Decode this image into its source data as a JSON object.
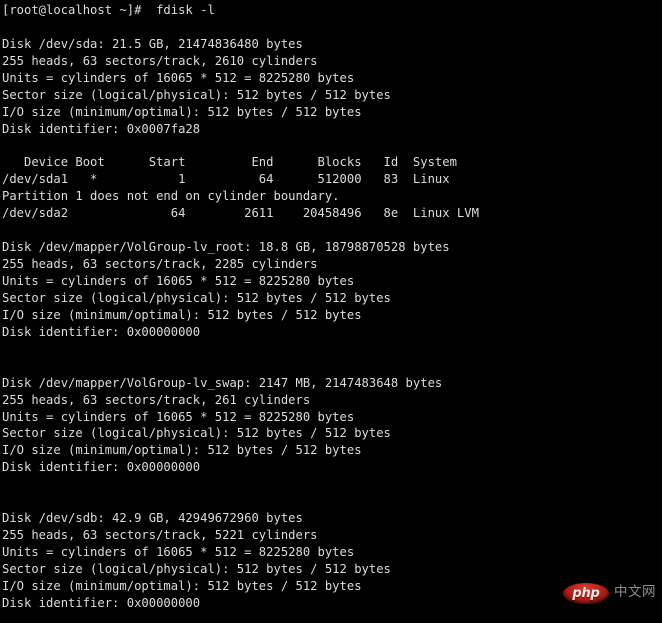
{
  "terminal": {
    "prompt": "[root@localhost ~]#",
    "command": "fdisk -l",
    "prompt_line": "[root@localhost ~]#  fdisk -l",
    "text_color": "#dcdcdc",
    "background_color": "#000000",
    "lines": [
      "[root@localhost ~]#  fdisk -l",
      "",
      "Disk /dev/sda: 21.5 GB, 21474836480 bytes",
      "255 heads, 63 sectors/track, 2610 cylinders",
      "Units = cylinders of 16065 * 512 = 8225280 bytes",
      "Sector size (logical/physical): 512 bytes / 512 bytes",
      "I/O size (minimum/optimal): 512 bytes / 512 bytes",
      "Disk identifier: 0x0007fa28",
      "",
      "   Device Boot      Start         End      Blocks   Id  System",
      "/dev/sda1   *           1          64      512000   83  Linux",
      "Partition 1 does not end on cylinder boundary.",
      "/dev/sda2              64        2611    20458496   8e  Linux LVM",
      "",
      "Disk /dev/mapper/VolGroup-lv_root: 18.8 GB, 18798870528 bytes",
      "255 heads, 63 sectors/track, 2285 cylinders",
      "Units = cylinders of 16065 * 512 = 8225280 bytes",
      "Sector size (logical/physical): 512 bytes / 512 bytes",
      "I/O size (minimum/optimal): 512 bytes / 512 bytes",
      "Disk identifier: 0x00000000",
      "",
      "",
      "Disk /dev/mapper/VolGroup-lv_swap: 2147 MB, 2147483648 bytes",
      "255 heads, 63 sectors/track, 261 cylinders",
      "Units = cylinders of 16065 * 512 = 8225280 bytes",
      "Sector size (logical/physical): 512 bytes / 512 bytes",
      "I/O size (minimum/optimal): 512 bytes / 512 bytes",
      "Disk identifier: 0x00000000",
      "",
      "",
      "Disk /dev/sdb: 42.9 GB, 42949672960 bytes",
      "255 heads, 63 sectors/track, 5221 cylinders",
      "Units = cylinders of 16065 * 512 = 8225280 bytes",
      "Sector size (logical/physical): 512 bytes / 512 bytes",
      "I/O size (minimum/optimal): 512 bytes / 512 bytes",
      "Disk identifier: 0x00000000"
    ],
    "disks": [
      {
        "device": "/dev/sda",
        "size_human": "21.5 GB",
        "size_bytes": "21474836480 bytes",
        "heads": "255",
        "sectors_per_track": "63",
        "cylinders": "2610",
        "units": "cylinders of 16065 * 512 = 8225280 bytes",
        "sector_size": "512 bytes / 512 bytes",
        "io_size": "512 bytes / 512 bytes",
        "identifier": "0x0007fa28",
        "partition_table": {
          "headers": [
            "Device",
            "Boot",
            "Start",
            "End",
            "Blocks",
            "Id",
            "System"
          ],
          "rows": [
            {
              "device": "/dev/sda1",
              "boot": "*",
              "start": "1",
              "end": "64",
              "blocks": "512000",
              "id": "83",
              "system": "Linux"
            },
            {
              "device": "/dev/sda2",
              "boot": "",
              "start": "64",
              "end": "2611",
              "blocks": "20458496",
              "id": "8e",
              "system": "Linux LVM"
            }
          ],
          "notes": [
            "Partition 1 does not end on cylinder boundary."
          ]
        }
      },
      {
        "device": "/dev/mapper/VolGroup-lv_root",
        "size_human": "18.8 GB",
        "size_bytes": "18798870528 bytes",
        "heads": "255",
        "sectors_per_track": "63",
        "cylinders": "2285",
        "units": "cylinders of 16065 * 512 = 8225280 bytes",
        "sector_size": "512 bytes / 512 bytes",
        "io_size": "512 bytes / 512 bytes",
        "identifier": "0x00000000"
      },
      {
        "device": "/dev/mapper/VolGroup-lv_swap",
        "size_human": "2147 MB",
        "size_bytes": "2147483648 bytes",
        "heads": "255",
        "sectors_per_track": "63",
        "cylinders": "261",
        "units": "cylinders of 16065 * 512 = 8225280 bytes",
        "sector_size": "512 bytes / 512 bytes",
        "io_size": "512 bytes / 512 bytes",
        "identifier": "0x00000000"
      },
      {
        "device": "/dev/sdb",
        "size_human": "42.9 GB",
        "size_bytes": "42949672960 bytes",
        "heads": "255",
        "sectors_per_track": "63",
        "cylinders": "5221",
        "units": "cylinders of 16065 * 512 = 8225280 bytes",
        "sector_size": "512 bytes / 512 bytes",
        "io_size": "512 bytes / 512 bytes",
        "identifier": "0x00000000"
      }
    ]
  },
  "watermark": {
    "badge_text": "php",
    "site_text": "中文网",
    "badge_color": "#bb1f1a",
    "badge_text_color": "#f2eceb",
    "site_text_color": "#8e8e8e"
  }
}
